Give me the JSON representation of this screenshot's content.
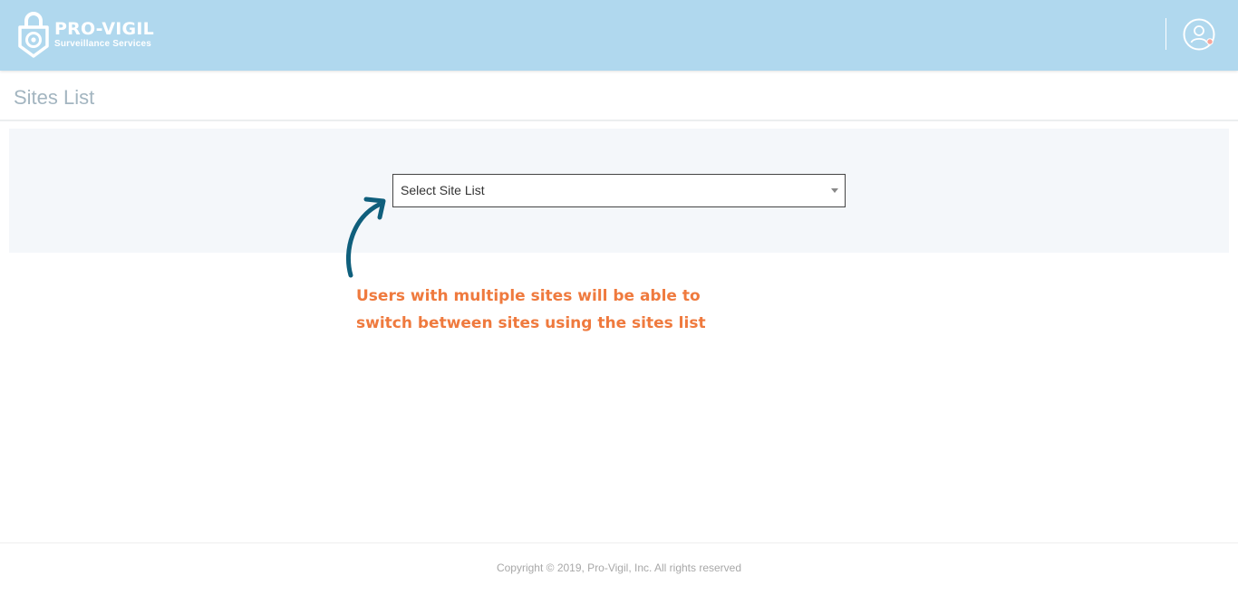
{
  "header": {
    "brand_name": "PRO-VIGIL",
    "brand_tagline": "Surveillance Services",
    "user_menu_icon": "user-avatar-icon",
    "notification_dot_color": "#f7a59a",
    "background_color": "#b0d8ee"
  },
  "page": {
    "title": "Sites List"
  },
  "site_select": {
    "value": "Select Site List",
    "caret_icon": "chevron-down-icon"
  },
  "annotation": {
    "line1": "Users with multiple sites will be able to",
    "line2": "switch between sites using the sites list",
    "arrow_icon": "curved-arrow-icon",
    "text_color": "#ef7a3e",
    "arrow_color": "#0f5f7c"
  },
  "footer": {
    "copyright": "Copyright © 2019, Pro-Vigil, Inc. All rights reserved"
  }
}
